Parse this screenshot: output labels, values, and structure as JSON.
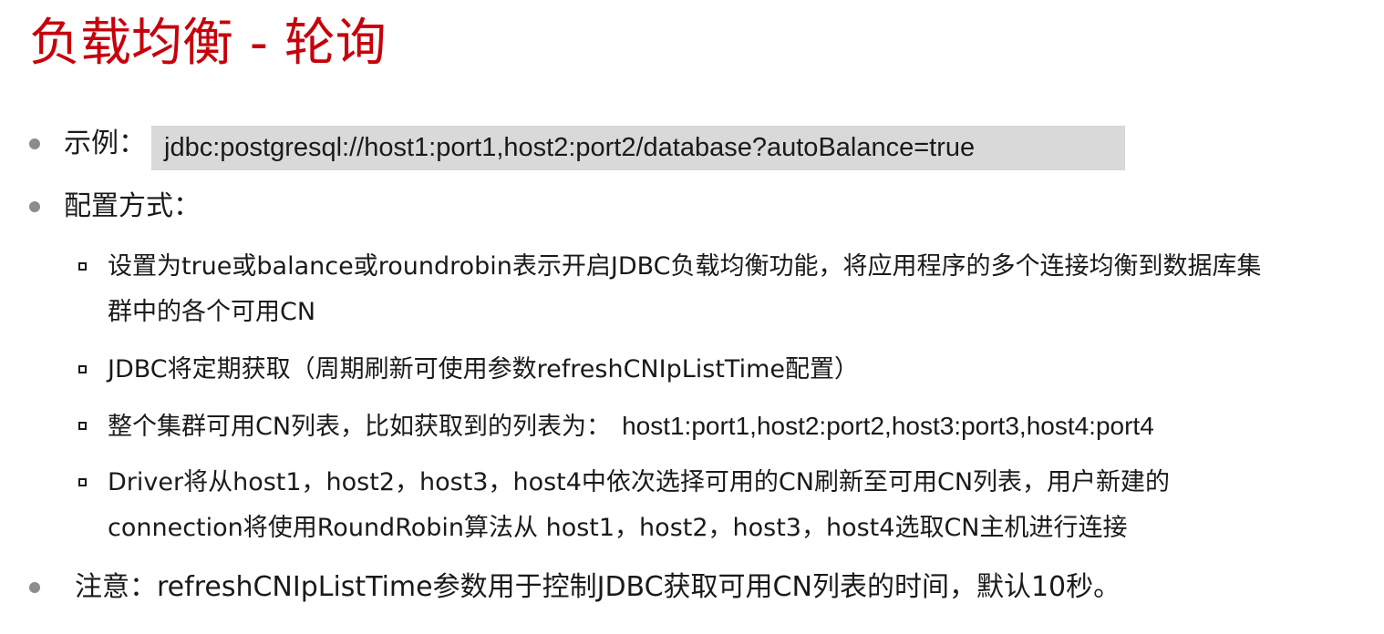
{
  "title": "负载均衡 - 轮询",
  "example": {
    "label": "示例：",
    "code": "jdbc:postgresql://host1:port1,host2:port2/database?autoBalance=true"
  },
  "config": {
    "label": "配置方式：",
    "items": [
      {
        "lines": [
          "设置为true或balance或roundrobin表示开启JDBC负载均衡功能，将应用程序的多个连接均衡到数据库集",
          "群中的各个可用CN"
        ]
      },
      {
        "lines": [
          "JDBC将定期获取（周期刷新可使用参数refreshCNIpListTime配置）"
        ]
      },
      {
        "text": "整个集群可用CN列表，比如获取到的列表为：",
        "code": "host1:port1,host2:port2,host3:port3,host4:port4"
      },
      {
        "lines": [
          "Driver将从host1，host2，host3，host4中依次选择可用的CN刷新至可用CN列表，用户新建的",
          "connection将使用RoundRobin算法从 host1，host2，host3，host4选取CN主机进行连接"
        ]
      }
    ]
  },
  "note": {
    "text": "注意：refreshCNIpListTime参数用于控制JDBC获取可用CN列表的时间，默认10秒。"
  }
}
